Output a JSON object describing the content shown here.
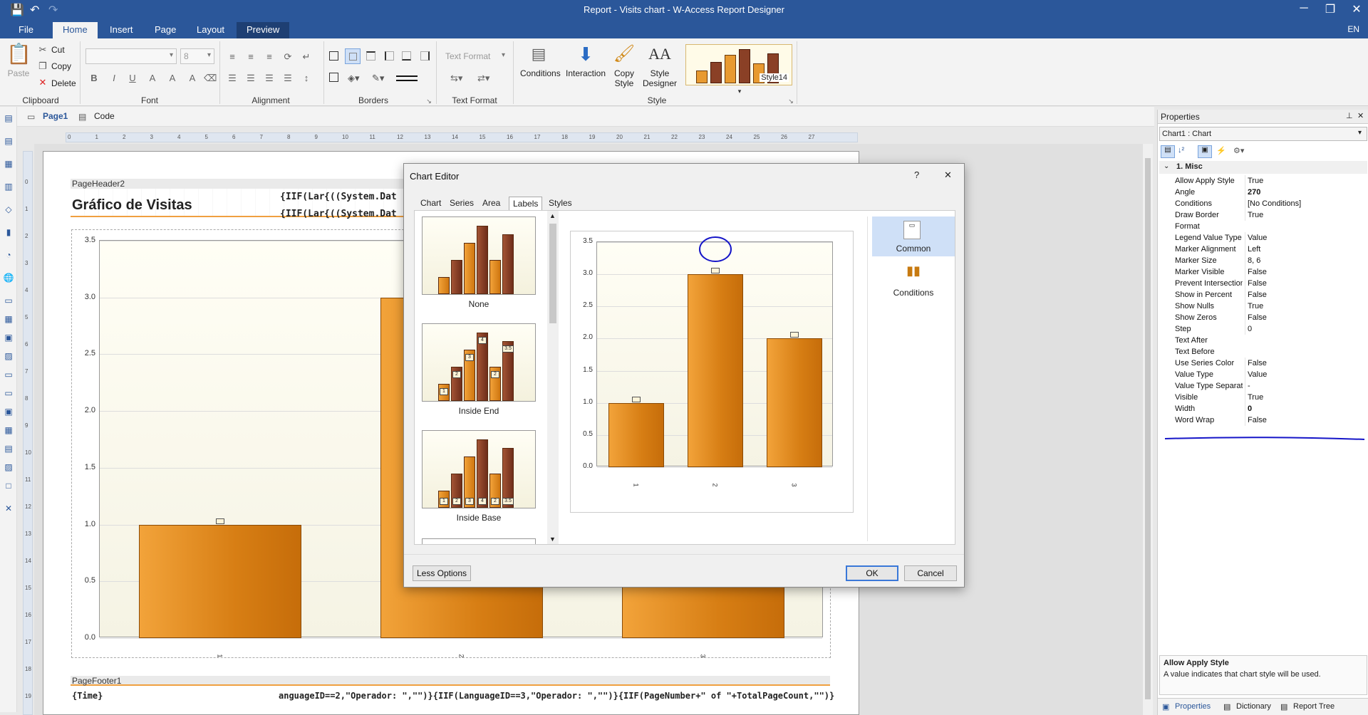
{
  "window": {
    "title": "Report - Visits chart - W-Access Report Designer",
    "lang": "EN"
  },
  "menu": {
    "tabs": [
      {
        "label": "File",
        "x": 12
      },
      {
        "label": "Home",
        "x": 74
      },
      {
        "label": "Insert",
        "x": 140
      },
      {
        "label": "Page",
        "x": 203
      },
      {
        "label": "Layout",
        "x": 262
      },
      {
        "label": "Preview",
        "x": 332
      }
    ]
  },
  "ribbon": {
    "clipboard": {
      "paste": "Paste",
      "cut": "Cut",
      "copy": "Copy",
      "delete": "Delete",
      "label": "Clipboard"
    },
    "font": {
      "size": "8",
      "label": "Font"
    },
    "alignment": {
      "label": "Alignment"
    },
    "borders": {
      "label": "Borders"
    },
    "textformat": {
      "combo": "Text Format",
      "label": "Text Format"
    },
    "style": {
      "conditions": "Conditions",
      "interaction": "Interaction",
      "copy_style_1": "Copy",
      "copy_style_2": "Style",
      "designer_1": "Style",
      "designer_2": "Designer",
      "style_name": "Style14",
      "label": "Style"
    }
  },
  "doctabs": {
    "page": "Page1",
    "code": "Code"
  },
  "report": {
    "header_band": "PageHeader2",
    "title": "Gráfico de Visitas",
    "expr1": "{IIF(Lar",
    "expr2": "{((System.Dat",
    "expr3": "{IIF(Lar",
    "expr4": "{((System.Dat",
    "footer_band": "PageFooter1",
    "footer_time": "{Time}",
    "footer_expr": "anguageID==2,\"Operador: \",\"\")}{IIF(LanguageID==3,\"Operador: \",\"\")}{IIF(PageNumber+\" of \"+TotalPageCount,\"\")}"
  },
  "chart_data": {
    "type": "bar",
    "categories": [
      "1",
      "2",
      "3"
    ],
    "values": [
      1.0,
      3.0,
      2.0
    ],
    "ylim": [
      0,
      3.5
    ],
    "yticks": [
      "3.5",
      "3.0",
      "2.5",
      "2.0",
      "1.5",
      "1.0",
      "0.5",
      "0.0"
    ],
    "grid": true
  },
  "dialog": {
    "title": "Chart Editor",
    "help": "?",
    "close": "✕",
    "tabs": [
      {
        "label": "Chart",
        "x": 10
      },
      {
        "label": "Series",
        "x": 51
      },
      {
        "label": "Area",
        "x": 97
      },
      {
        "label": "Labels",
        "x": 139,
        "active": true
      },
      {
        "label": "Styles",
        "x": 190
      }
    ],
    "thumbs": [
      "None",
      "Inside End",
      "Inside Base"
    ],
    "thumb_vals1": [
      "1",
      "2",
      "3",
      "4",
      "2",
      "3.5"
    ],
    "right": {
      "common": "Common",
      "conditions": "Conditions"
    },
    "less_options": "Less Options",
    "ok": "OK",
    "cancel": "Cancel"
  },
  "props": {
    "title": "Properties",
    "object": "Chart1 : Chart",
    "category": "1. Misc",
    "rows": [
      {
        "name": "Allow Apply Style",
        "value": "True"
      },
      {
        "name": "Angle",
        "value": "270"
      },
      {
        "name": "Conditions",
        "value": "[No Conditions]"
      },
      {
        "name": "Draw Border",
        "value": "True"
      },
      {
        "name": "Format",
        "value": ""
      },
      {
        "name": "Legend Value Type",
        "value": "Value"
      },
      {
        "name": "Marker Alignment",
        "value": "Left"
      },
      {
        "name": "Marker Size",
        "value": "8, 6"
      },
      {
        "name": "Marker Visible",
        "value": "False"
      },
      {
        "name": "Prevent Intersection",
        "value": "False"
      },
      {
        "name": "Show in Percent",
        "value": "False"
      },
      {
        "name": "Show Nulls",
        "value": "True"
      },
      {
        "name": "Show Zeros",
        "value": "False"
      },
      {
        "name": "Step",
        "value": "0"
      },
      {
        "name": "Text After",
        "value": ""
      },
      {
        "name": "Text Before",
        "value": ""
      },
      {
        "name": "Use Series Color",
        "value": "False"
      },
      {
        "name": "Value Type",
        "value": "Value"
      },
      {
        "name": "Value Type Separator",
        "value": "-"
      },
      {
        "name": "Visible",
        "value": "True"
      },
      {
        "name": "Width",
        "value": "0"
      },
      {
        "name": "Word Wrap",
        "value": "False"
      }
    ],
    "desc_title": "Allow Apply Style",
    "desc_text": "A value indicates that chart style will be used.",
    "bottom_tabs": [
      "Properties",
      "Dictionary",
      "Report Tree"
    ]
  }
}
